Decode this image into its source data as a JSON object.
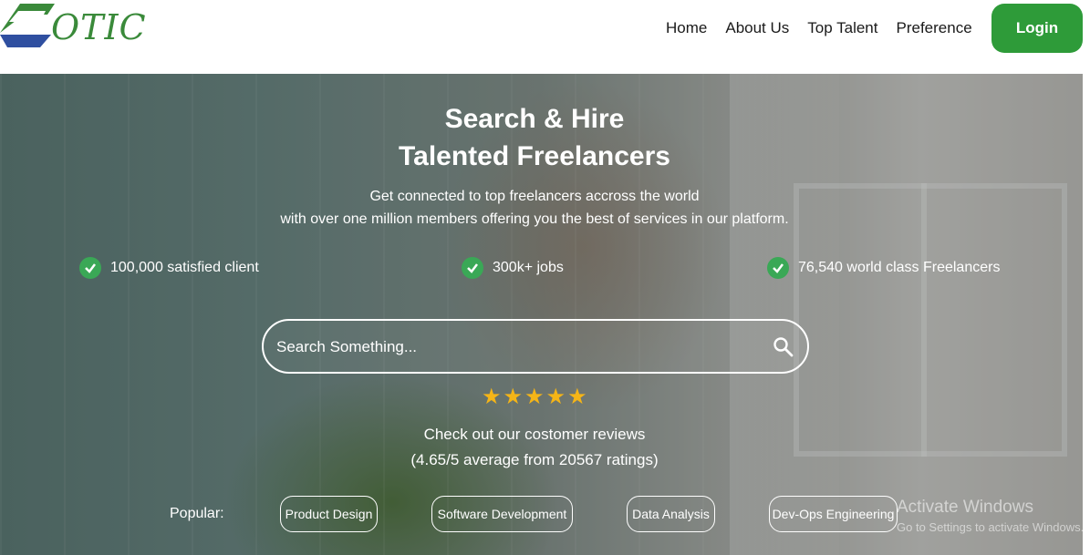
{
  "header": {
    "logo_text": "OTIC",
    "nav": [
      "Home",
      "About Us",
      "Top Talent",
      "Preference"
    ],
    "login_label": "Login"
  },
  "hero": {
    "title_line1": "Search & Hire",
    "title_line2": "Talented Freelancers",
    "subtitle_line1": "Get connected to top freelancers accross the world",
    "subtitle_line2": "with over one million members offering you the best of services in our platform.",
    "stats": [
      "100,000 satisfied client",
      "300k+ jobs",
      "76,540 world class Freelancers"
    ]
  },
  "search": {
    "placeholder": "Search Something..."
  },
  "reviews": {
    "stars": 5,
    "line1": "Check out our costomer reviews",
    "line2": "(4.65/5 average from 20567 ratings)"
  },
  "popular": {
    "label": "Popular:",
    "chips": [
      "Product Design",
      "Software Development",
      "Data Analysis",
      "Dev-Ops Engineering"
    ]
  },
  "watermark": {
    "title": "Activate Windows",
    "subtitle": "Go to Settings to activate Windows."
  },
  "colors": {
    "brand_green": "#2e9b39",
    "check_green": "#3aa856",
    "star_gold": "#f5b517"
  }
}
